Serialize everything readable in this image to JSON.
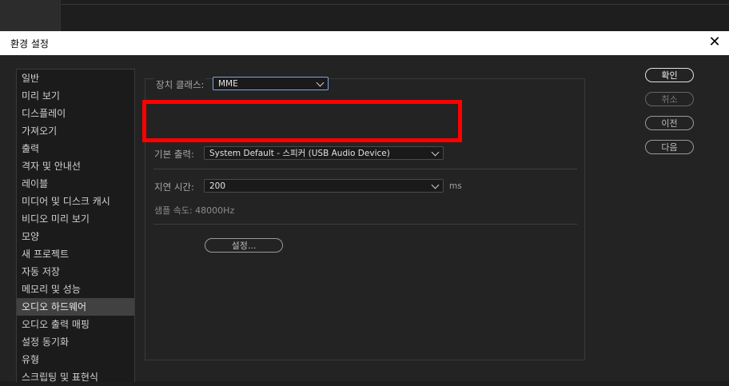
{
  "dialog": {
    "title": "환경 설정",
    "close_glyph": "✕"
  },
  "sidebar": {
    "items": [
      {
        "label": "일반"
      },
      {
        "label": "미리 보기"
      },
      {
        "label": "디스플레이"
      },
      {
        "label": "가져오기"
      },
      {
        "label": "출력"
      },
      {
        "label": "격자 및 안내선"
      },
      {
        "label": "레이블"
      },
      {
        "label": "미디어 및 디스크 캐시"
      },
      {
        "label": "비디오 미리 보기"
      },
      {
        "label": "모양"
      },
      {
        "label": "새 프로젝트"
      },
      {
        "label": "자동 저장"
      },
      {
        "label": "메모리 및 성능"
      },
      {
        "label": "오디오 하드웨어"
      },
      {
        "label": "오디오 출력 매핑"
      },
      {
        "label": "설정 동기화"
      },
      {
        "label": "유형"
      },
      {
        "label": "스크립팅 및 표현식"
      }
    ],
    "active_index": 13
  },
  "audio_hardware": {
    "device_class_label": "장치 클래스:",
    "device_class_value": "MME",
    "default_output_label": "기본 출력:",
    "default_output_value": "System Default - 스피커 (USB Audio Device)",
    "latency_label": "지연 시간:",
    "latency_value": "200",
    "latency_unit": "ms",
    "sample_rate_text": "샘플 속도: 48000Hz",
    "settings_button": "설정..."
  },
  "buttons": {
    "ok": "확인",
    "cancel": "취소",
    "prev": "이전",
    "next": "다음"
  },
  "colors": {
    "highlight": "#ff0000",
    "active_item": "#414141"
  }
}
